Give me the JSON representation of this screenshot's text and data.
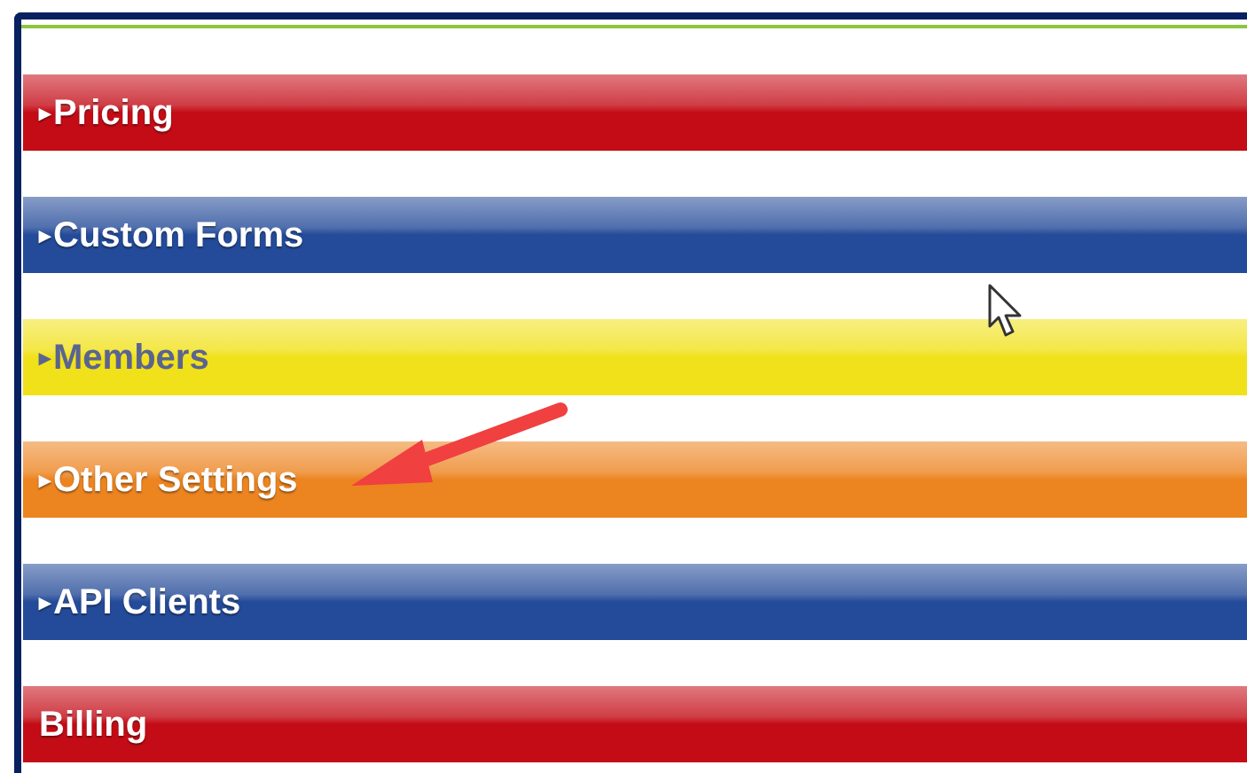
{
  "sections": [
    {
      "toggle": "▸",
      "label": "Pricing",
      "color": "#c40c16"
    },
    {
      "toggle": "▸",
      "label": "Custom Forms",
      "color": "#244b99"
    },
    {
      "toggle": "▸",
      "label": "Members",
      "color": "#f1e11a"
    },
    {
      "toggle": "▸",
      "label": "Other Settings",
      "color": "#ec8420"
    },
    {
      "toggle": "▸",
      "label": "API Clients",
      "color": "#244b99"
    },
    {
      "label": "Billing",
      "color": "#c40c16"
    }
  ]
}
